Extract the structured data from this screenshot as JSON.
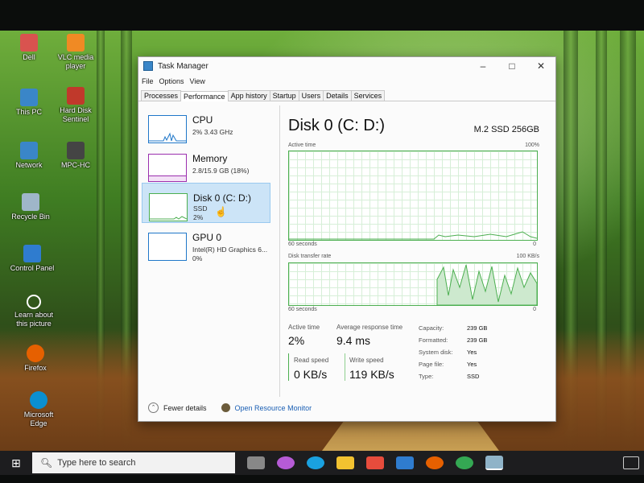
{
  "desktop": {
    "icons": [
      {
        "label": "Dell",
        "color": "#d9534f"
      },
      {
        "label": "VLC media player",
        "color": "#f08a24"
      },
      {
        "label": "This PC",
        "color": "#3a86c8"
      },
      {
        "label": "Hard Disk Sentinel",
        "color": "#c0392b"
      },
      {
        "label": "Network",
        "color": "#3a86c8"
      },
      {
        "label": "MPC-HC",
        "color": "#444444"
      },
      {
        "label": "Recycle Bin",
        "color": "#9fb6c9"
      },
      {
        "label": "Control Panel",
        "color": "#2f7ccf"
      },
      {
        "label": "Learn about this picture",
        "color": "#333333"
      },
      {
        "label": "Firefox",
        "color": "#e66000"
      },
      {
        "label": "Microsoft Edge",
        "color": "#0b8fd0"
      }
    ]
  },
  "window": {
    "title": "Task Manager",
    "menu": [
      "File",
      "Options",
      "View"
    ],
    "tabs": [
      "Processes",
      "Performance",
      "App history",
      "Startup",
      "Users",
      "Details",
      "Services"
    ],
    "active_tab": "Performance"
  },
  "left_panel": {
    "items": [
      {
        "name": "CPU",
        "line1": "2%  3.43 GHz",
        "line2": "",
        "color": "#1f77c9"
      },
      {
        "name": "Memory",
        "line1": "2.8/15.9 GB (18%)",
        "line2": "",
        "color": "#9b2fae"
      },
      {
        "name": "Disk 0 (C: D:)",
        "line1": "SSD",
        "line2": "2%",
        "color": "#4caf50",
        "selected": true
      },
      {
        "name": "GPU 0",
        "line1": "Intel(R) HD Graphics 6...",
        "line2": "0%",
        "color": "#1f77c9"
      }
    ]
  },
  "disk": {
    "title": "Disk 0 (C: D:)",
    "model": "M.2 SSD 256GB",
    "graph1": {
      "label": "Active time",
      "max": "100%",
      "time": "60 seconds",
      "min": "0"
    },
    "graph2": {
      "label": "Disk transfer rate",
      "max": "100 KB/s",
      "time": "60 seconds",
      "min": "0"
    },
    "stats": {
      "active_time_label": "Active time",
      "active_time_value": "2%",
      "avg_resp_label": "Average response time",
      "avg_resp_value": "9.4 ms",
      "read_label": "Read speed",
      "read_value": "0 KB/s",
      "write_label": "Write speed",
      "write_value": "119 KB/s"
    },
    "properties": [
      {
        "key": "Capacity:",
        "value": "239 GB"
      },
      {
        "key": "Formatted:",
        "value": "239 GB"
      },
      {
        "key": "System disk:",
        "value": "Yes"
      },
      {
        "key": "Page file:",
        "value": "Yes"
      },
      {
        "key": "Type:",
        "value": "SSD"
      }
    ]
  },
  "footer": {
    "fewer_details": "Fewer details",
    "resource_monitor": "Open Resource Monitor"
  },
  "taskbar": {
    "search_placeholder": "Type here to search",
    "icons": [
      {
        "name": "task-view",
        "color": "#888888"
      },
      {
        "name": "copilot",
        "color": "#b65bd6"
      },
      {
        "name": "edge",
        "color": "#1aa1e0"
      },
      {
        "name": "file-explorer",
        "color": "#f2c230"
      },
      {
        "name": "store",
        "color": "#e74c3c"
      },
      {
        "name": "mail",
        "color": "#2f7ccf"
      },
      {
        "name": "firefox",
        "color": "#e66000"
      },
      {
        "name": "chrome",
        "color": "#34a853"
      },
      {
        "name": "task-manager",
        "color": "#8fb3c8"
      }
    ]
  }
}
